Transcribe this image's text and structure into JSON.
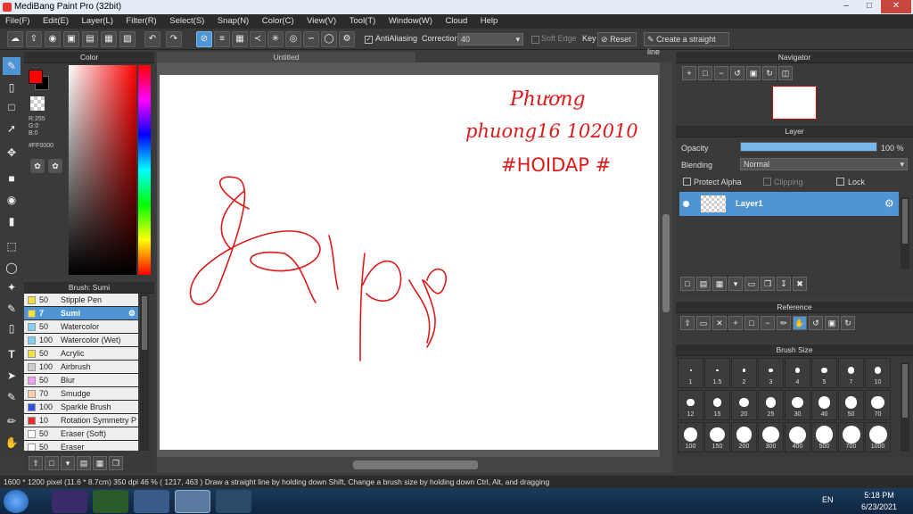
{
  "window": {
    "title": "MediBang Paint Pro (32bit)"
  },
  "menu": [
    "File(F)",
    "Edit(E)",
    "Layer(L)",
    "Filter(R)",
    "Select(S)",
    "Snap(N)",
    "Color(C)",
    "View(V)",
    "Tool(T)",
    "Window(W)",
    "Cloud",
    "Help"
  ],
  "toolbar": {
    "antialiasing": "AntiAliasing",
    "correction_label": "Correction",
    "correction_value": "40",
    "soft_edge": "Soft Edge",
    "key": "Key",
    "reset": "Reset",
    "straight_line": "Create a straight line"
  },
  "color_panel": {
    "title": "Color",
    "r": "R:255",
    "g": "G:0",
    "b": "B:0",
    "hex": "#FF0000",
    "primary": "#ff0000",
    "secondary": "#000000"
  },
  "brush_panel": {
    "title": "Brush: Sumi",
    "items": [
      {
        "size": "50",
        "name": "Stipple Pen",
        "color": "#f0e040"
      },
      {
        "size": "7",
        "name": "Sumi",
        "color": "#f0e040",
        "active": true
      },
      {
        "size": "50",
        "name": "Watercolor",
        "color": "#7fd0f0"
      },
      {
        "size": "100",
        "name": "Watercolor (Wet)",
        "color": "#7fd0f0"
      },
      {
        "size": "50",
        "name": "Acrylic",
        "color": "#f0e040"
      },
      {
        "size": "100",
        "name": "Airbrush",
        "color": "#cccccc"
      },
      {
        "size": "50",
        "name": "Blur",
        "color": "#f0a0f0"
      },
      {
        "size": "70",
        "name": "Smudge",
        "color": "#f8d0b0"
      },
      {
        "size": "100",
        "name": "Sparkle Brush",
        "color": "#3050e0"
      },
      {
        "size": "10",
        "name": "Rotation Symmetry P",
        "color": "#e03030"
      },
      {
        "size": "50",
        "name": "Eraser (Soft)",
        "color": "#ffffff"
      },
      {
        "size": "50",
        "name": "Eraser",
        "color": "#ffffff"
      }
    ]
  },
  "document": {
    "tab": "Untitled"
  },
  "canvas_text": {
    "line1": "Phương",
    "line2": "phuong16 102010",
    "line3": "#HOIDAP #"
  },
  "navigator": {
    "title": "Navigator"
  },
  "layer_panel": {
    "title": "Layer",
    "opacity_label": "Opacity",
    "opacity_value": "100 %",
    "opacity": 1.0,
    "blending_label": "Blending",
    "blending_value": "Normal",
    "protect_alpha": "Protect Alpha",
    "clipping": "Clipping",
    "lock": "Lock",
    "layer_name": "Layer1"
  },
  "reference_panel": {
    "title": "Reference"
  },
  "brush_size_panel": {
    "title": "Brush Size",
    "sizes": [
      "1",
      "1.5",
      "2",
      "3",
      "4",
      "5",
      "7",
      "10",
      "12",
      "15",
      "20",
      "25",
      "30",
      "40",
      "50",
      "70",
      "100",
      "150",
      "200",
      "300",
      "400",
      "500",
      "700",
      "1000"
    ]
  },
  "status": {
    "text": "1600 * 1200 pixel   (11.6 * 8.7cm)   350 dpi   46 %   ( 1217, 463 )   Draw a straight line by holding down Shift, Change a brush size by holding down Ctrl, Alt, and dragging"
  },
  "taskbar": {
    "lang": "EN",
    "time": "5:18 PM",
    "date": "6/23/2021"
  }
}
